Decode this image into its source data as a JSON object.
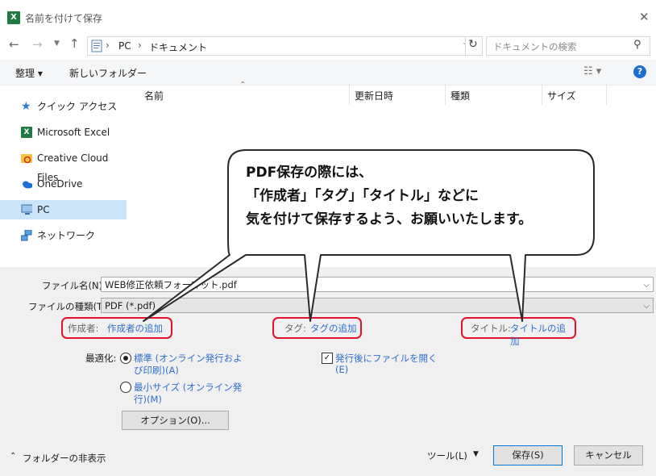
{
  "window": {
    "title": "名前を付けて保存",
    "close_glyph": "✕"
  },
  "address": {
    "breadcrumb": [
      "PC",
      "ドキュメント"
    ],
    "search_placeholder": "ドキュメントの検索"
  },
  "toolbar": {
    "organize": "整理 ▾",
    "new_folder": "新しいフォルダー",
    "help": "?"
  },
  "columns": [
    "名前",
    "更新日時",
    "種類",
    "サイズ"
  ],
  "sidebar": {
    "items": [
      {
        "label": "クイック アクセス",
        "icon": "star-icon"
      },
      {
        "label": "Microsoft Excel",
        "icon": "excel-icon"
      },
      {
        "label": "Creative Cloud Files",
        "icon": "creative-cloud-icon"
      },
      {
        "label": "OneDrive",
        "icon": "cloud-icon"
      },
      {
        "label": "PC",
        "icon": "monitor-icon",
        "selected": true
      },
      {
        "label": "ネットワーク",
        "icon": "network-icon"
      }
    ]
  },
  "callout": {
    "lines": [
      "PDF保存の際には、",
      "「作成者」「タグ」「タイトル」などに",
      "気を付けて保存するよう、お願いいたします。"
    ]
  },
  "form": {
    "filename_label": "ファイル名(N):",
    "filename_value": "WEB修正依頼フォーマット.pdf",
    "filetype_label": "ファイルの種類(T):",
    "filetype_value": "PDF (*.pdf)",
    "author_label": "作成者:",
    "author_link": "作成者の追加",
    "tag_label": "タグ:",
    "tag_link": "タグの追加",
    "title_label": "タイトル:",
    "title_link": "タイトルの追加",
    "optimize_label": "最適化:",
    "opt_standard_1": "標準 (オンライン発行およ",
    "opt_standard_2": "び印刷)(A)",
    "opt_min_1": "最小サイズ (オンライン発",
    "opt_min_2": "行)(M)",
    "options_button": "オプション(O)...",
    "open_after_1": "発行後にファイルを開く",
    "open_after_2": "(E)"
  },
  "footer": {
    "hide_folders": "フォルダーの非表示",
    "tools": "ツール(L)",
    "save": "保存(S)",
    "cancel": "キャンセル"
  },
  "colors": {
    "accent": "#2f6fcd",
    "highlight_red": "#e5102a",
    "selected_bg": "#cce4f7",
    "excel_green": "#1f7a43"
  }
}
